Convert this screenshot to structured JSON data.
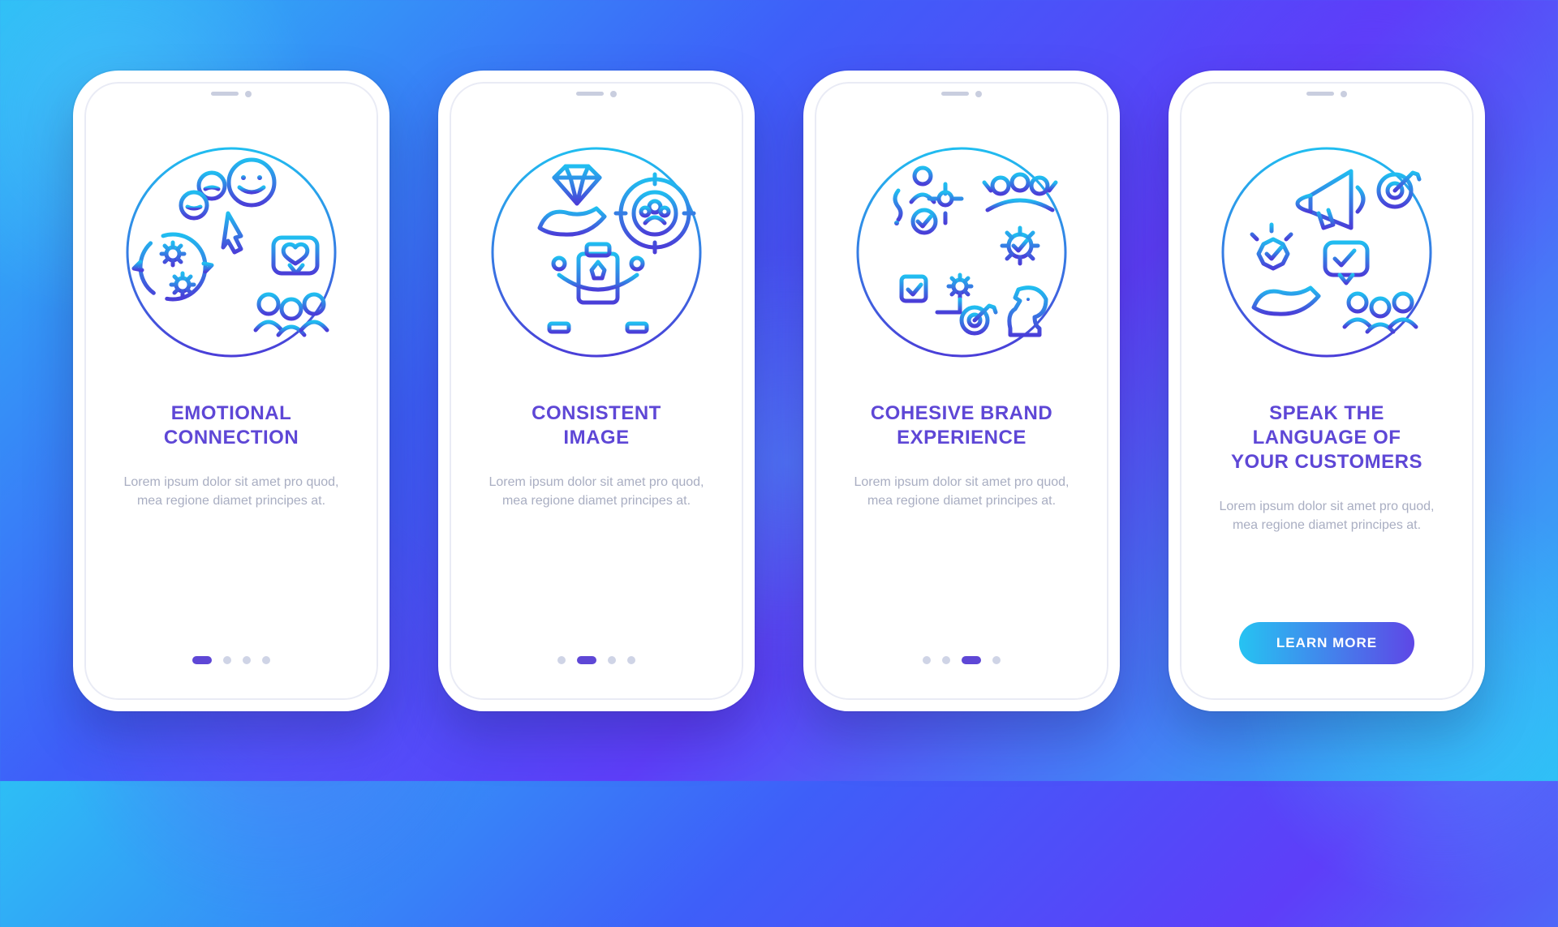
{
  "colors": {
    "title": "#5E47D6",
    "desc": "#A9AEC2",
    "dot_inactive": "#CFD4E6",
    "dot_active": "#5E47D6",
    "cta_gradient_from": "#26C3F2",
    "cta_gradient_to": "#5E47E6",
    "illustration_stroke_from": "#20BDF0",
    "illustration_stroke_to": "#4A3ED8"
  },
  "screens": [
    {
      "icon": "emotional-connection-icon",
      "title": "EMOTIONAL\nCONNECTION",
      "desc": "Lorem ipsum dolor sit amet pro quod, mea regione diamet principes at.",
      "active_dot": 0,
      "dot_count": 4
    },
    {
      "icon": "consistent-image-icon",
      "title": "CONSISTENT\nIMAGE",
      "desc": "Lorem ipsum dolor sit amet pro quod, mea regione diamet principes at.",
      "active_dot": 1,
      "dot_count": 4
    },
    {
      "icon": "cohesive-brand-icon",
      "title": "COHESIVE BRAND\nEXPERIENCE",
      "desc": "Lorem ipsum dolor sit amet pro quod, mea regione diamet principes at.",
      "active_dot": 2,
      "dot_count": 4
    },
    {
      "icon": "customer-language-icon",
      "title": "SPEAK THE\nLANGUAGE OF\nYOUR CUSTOMERS",
      "desc": "Lorem ipsum dolor sit amet pro quod, mea regione diamet principes at.",
      "cta_label": "LEARN MORE"
    }
  ]
}
